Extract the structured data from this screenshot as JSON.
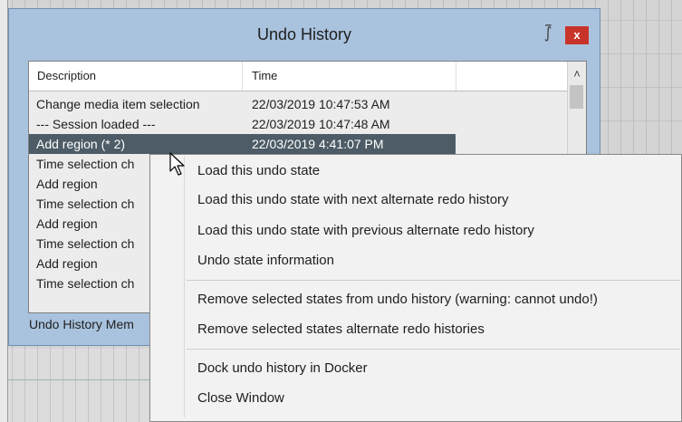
{
  "window": {
    "title": "Undo History",
    "close_label": "x",
    "pin_glyph": "⨛"
  },
  "list": {
    "columns": {
      "description": "Description",
      "time": "Time"
    },
    "rows": [
      {
        "description": "Change media item selection",
        "time": "22/03/2019 10:47:53 AM"
      },
      {
        "description": "--- Session loaded ---",
        "time": "22/03/2019 10:47:48 AM"
      },
      {
        "description": "Add region (* 2)",
        "time": "22/03/2019 4:41:07 PM",
        "selected": true
      },
      {
        "description": "Time selection ch",
        "time": ""
      },
      {
        "description": "Add region",
        "time": ""
      },
      {
        "description": "Time selection ch",
        "time": ""
      },
      {
        "description": "Add region",
        "time": ""
      },
      {
        "description": "Time selection ch",
        "time": ""
      },
      {
        "description": "Add region",
        "time": ""
      },
      {
        "description": "Time selection ch",
        "time": ""
      }
    ],
    "scroll_up_glyph": "˄"
  },
  "footer": {
    "text": "Undo History Mem"
  },
  "context_menu": {
    "items": [
      "Load this undo state",
      "Load this undo state with next alternate redo history",
      "Load this undo state with previous alternate redo history",
      "Undo state information",
      "Remove selected states from undo history (warning: cannot undo!)",
      "Remove selected states alternate redo histories",
      "Dock undo history in Docker",
      "Close Window"
    ]
  },
  "icons": {
    "pin": "pin-icon",
    "close": "close-icon",
    "cursor": "mouse-pointer-icon",
    "scroll_up": "scroll-up-arrow-icon"
  },
  "colors": {
    "dialog_bg": "#a9c3de",
    "close_button": "#c9342a",
    "selected_row": "#4d5c66",
    "menu_bg": "#f2f2f2"
  }
}
